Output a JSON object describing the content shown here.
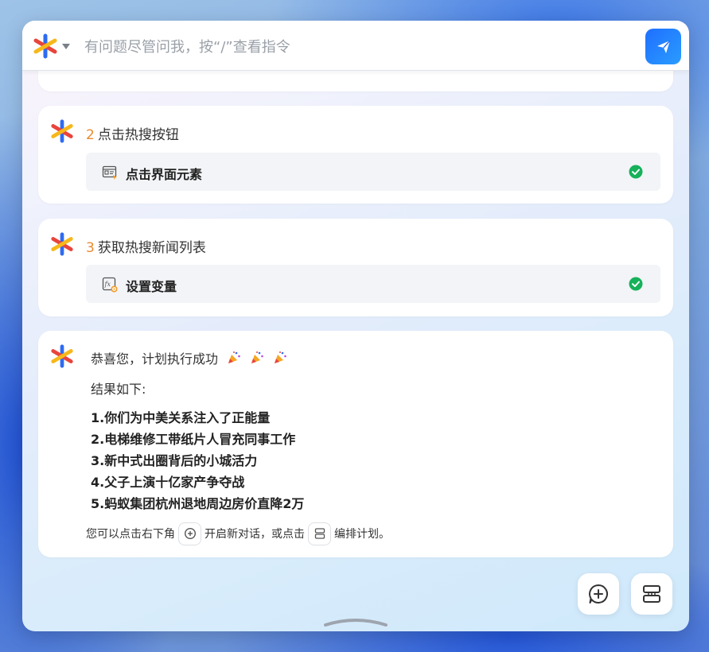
{
  "search": {
    "placeholder": "有问题尽管问我，按“/”查看指令"
  },
  "steps": [
    {
      "number": "2",
      "title": "点击热搜按钮",
      "action": {
        "icon": "click-element-icon",
        "label": "点击界面元素"
      }
    },
    {
      "number": "3",
      "title": "获取热搜新闻列表",
      "action": {
        "icon": "set-variable-icon",
        "label": "设置变量"
      }
    }
  ],
  "message": {
    "greeting": "恭喜您，计划执行成功",
    "result_intro": "结果如下:",
    "results": [
      "1.你们为中美关系注入了正能量",
      "2.电梯维修工带纸片人冒充同事工作",
      "3.新中式出圈背后的小城活力",
      "4.父子上演十亿家产争夺战",
      "5.蚂蚁集团杭州退地周边房价直降2万"
    ],
    "hint": {
      "part1": "您可以点击右下角",
      "part2": "开启新对话，或点击",
      "part3": "编排计划。"
    }
  },
  "colors": {
    "accent": "#1f6fff",
    "step_number": "#ea8a2e",
    "success": "#16b15a"
  }
}
